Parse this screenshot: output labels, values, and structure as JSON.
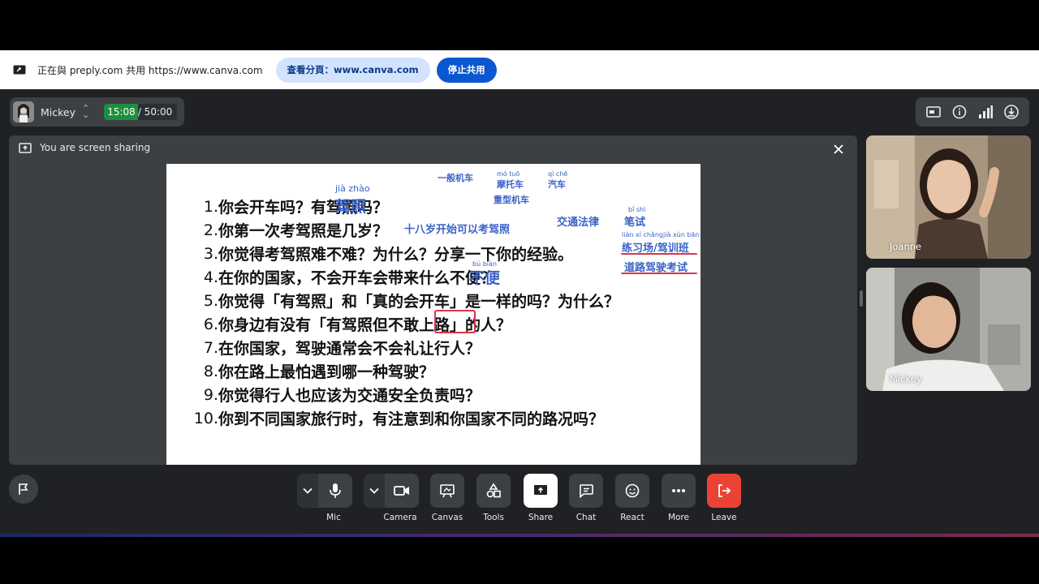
{
  "sharebar": {
    "text": "正在與 preply.com 共用 https://www.canva.com",
    "view_tab": "查看分頁：www.canva.com",
    "stop_share": "停止共用"
  },
  "meeting": {
    "user": "Mickey",
    "timer_elapsed": "15:08",
    "timer_rest": " / 50:00",
    "sharing_banner": "You are screen sharing"
  },
  "slide": {
    "questions": [
      {
        "num": "1.",
        "text": "你会开车吗？有驾照吗？"
      },
      {
        "num": "2.",
        "text": "你第一次考驾照是几岁？"
      },
      {
        "num": "3.",
        "text": "你觉得考驾照难不难？为什么？分享一下你的经验。"
      },
      {
        "num": "4.",
        "text": "在你的国家，不会开车会带来什么不便？"
      },
      {
        "num": "5.",
        "text": "你觉得「有驾照」和「真的会开车」是一样的吗？为什么？"
      },
      {
        "num": "6.",
        "text": "你身边有没有「有驾照但不敢上路」的人？"
      },
      {
        "num": "7.",
        "text": "在你国家，驾驶通常会不会礼让行人？"
      },
      {
        "num": "8.",
        "text": "你在路上最怕遇到哪一种驾驶？"
      },
      {
        "num": "9.",
        "text": "你觉得行人也应该为交通安全负责吗？"
      },
      {
        "num": "10.",
        "text": "你到不同国家旅行时，有注意到和你国家不同的路况吗？"
      }
    ],
    "notes": {
      "jiazhao_py": "jià zhào",
      "jiazhao": "驾照",
      "age_note": "十八岁开始可以考驾照",
      "yiban": "一般机车",
      "motuo_py": "mó tuō",
      "motuo": "摩托车",
      "qiche_py": "qì chē",
      "qiche": "汽车",
      "zhongxing": "重型机车",
      "jiaotong": "交通法律",
      "bishi_py": "bǐ shì",
      "bishi": "笔试",
      "lianxi_py": "liàn xí chǎng",
      "jiaxun_py": "jià xùn bān",
      "lianxi": "练习场/驾训班",
      "daolu": "道路驾驶考试",
      "bubian_py": "bú biàn",
      "bubian": "不便"
    }
  },
  "participants": [
    {
      "name": "Joanne"
    },
    {
      "name": "Mickey"
    }
  ],
  "controls": {
    "mic": "Mic",
    "camera": "Camera",
    "canvas": "Canvas",
    "tools": "Tools",
    "share": "Share",
    "chat": "Chat",
    "react": "React",
    "more": "More",
    "leave": "Leave"
  },
  "colors": {
    "accent_blue": "#0b57d0",
    "annotation_blue": "#3b62c7",
    "annotation_red": "#d9364a",
    "leave_red": "#ea4335",
    "timer_green": "#1e8e3e"
  }
}
